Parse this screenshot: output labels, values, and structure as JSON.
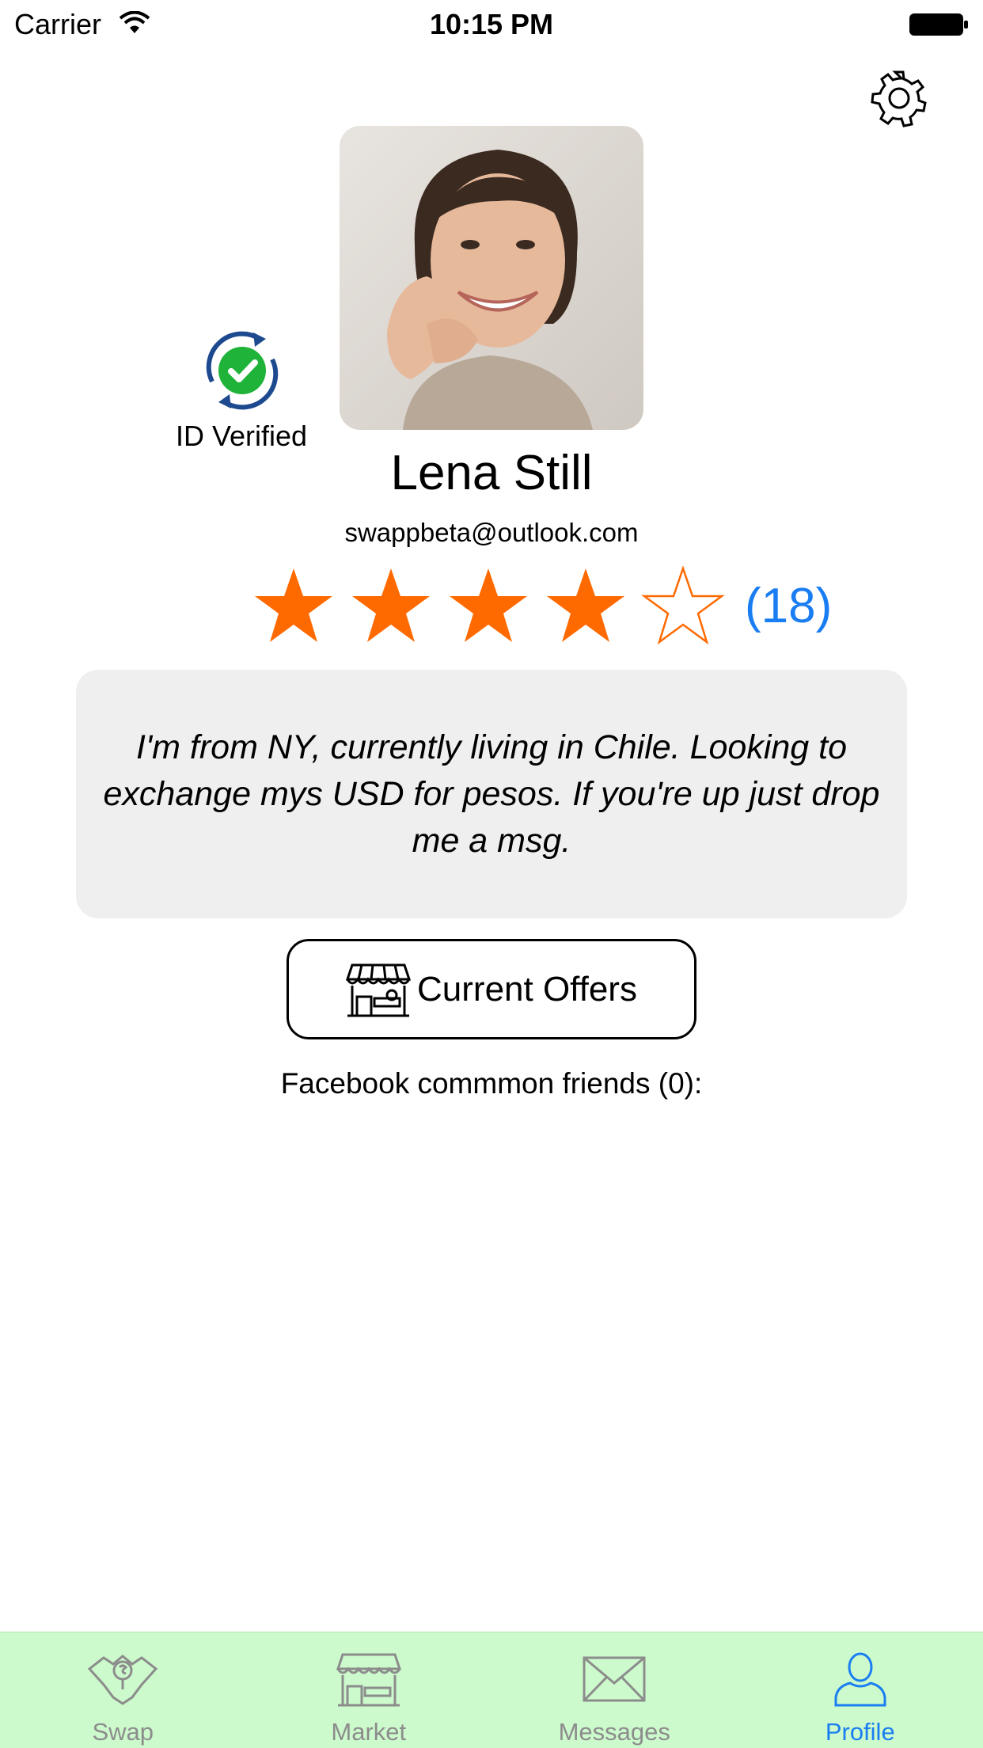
{
  "status_bar": {
    "carrier": "Carrier",
    "time": "10:15 PM"
  },
  "profile": {
    "verified_label": "ID Verified",
    "name": "Lena Still",
    "email": "swappbeta@outlook.com",
    "rating": {
      "value": 4,
      "max": 5,
      "count": "(18)"
    },
    "bio": "I'm from NY, currently living in Chile. Looking to exchange mys USD for pesos. If you're up just drop me a msg."
  },
  "actions": {
    "current_offers_label": "Current Offers"
  },
  "friends": {
    "label": "Facebook commmon friends (0):"
  },
  "tab_bar": {
    "tabs": [
      {
        "label": "Swap",
        "icon": "swap-icon",
        "active": false
      },
      {
        "label": "Market",
        "icon": "market-icon",
        "active": false
      },
      {
        "label": "Messages",
        "icon": "envelope-icon",
        "active": false
      },
      {
        "label": "Profile",
        "icon": "person-icon",
        "active": true
      }
    ]
  },
  "colors": {
    "star": "#ff6a00",
    "accent": "#1a7ef2",
    "tab_bar_bg": "#ccfacc",
    "verified_green": "#1fb33a",
    "verified_ring": "#1d4a8f"
  }
}
